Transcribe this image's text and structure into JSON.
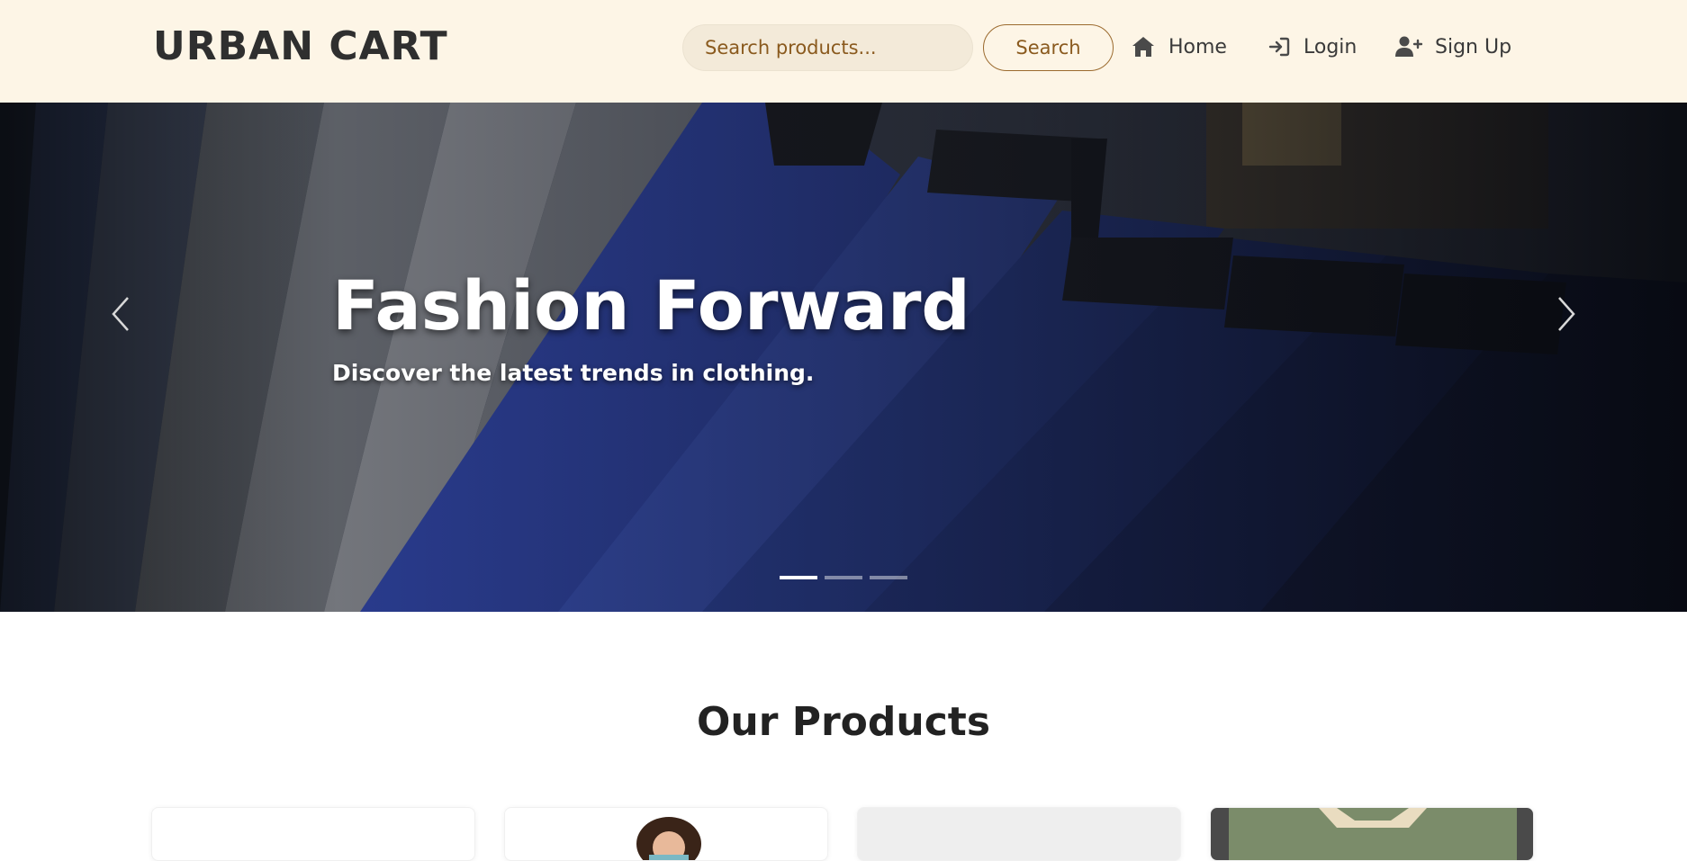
{
  "header": {
    "brand": "URBAN CART",
    "search": {
      "placeholder": "Search products...",
      "value": "",
      "button_label": "Search"
    },
    "nav": [
      {
        "label": "Home",
        "icon": "home-icon"
      },
      {
        "label": "Login",
        "icon": "login-icon"
      },
      {
        "label": "Sign Up",
        "icon": "user-plus-icon"
      }
    ]
  },
  "hero": {
    "title": "Fashion Forward",
    "subtitle": "Discover the latest trends in clothing.",
    "active_slide": 1,
    "slide_count": 3,
    "prev_icon": "chevron-left-icon",
    "next_icon": "chevron-right-icon"
  },
  "products": {
    "heading": "Our Products"
  },
  "colors": {
    "header_bg": "#fdf5e6",
    "accent": "#8a5a1e",
    "text_dark": "#2f2f2f"
  }
}
